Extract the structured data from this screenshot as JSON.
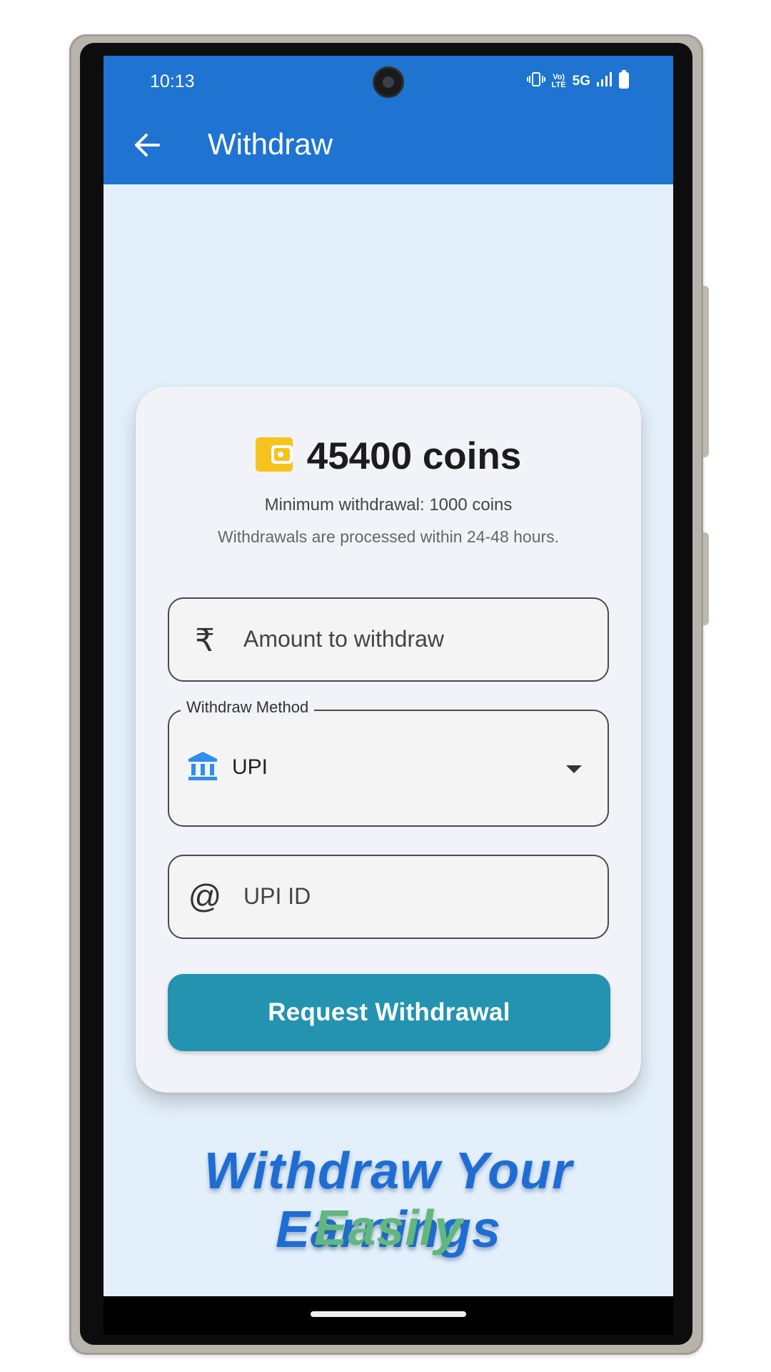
{
  "status_bar": {
    "time": "10:13",
    "icons": [
      "vibrate-icon",
      "volte-icon",
      "5g-icon",
      "signal-icon",
      "battery-icon"
    ],
    "volte_label": "Vo) LTE",
    "network_label": "5G"
  },
  "app_bar": {
    "title": "Withdraw",
    "background": "#1e74d0"
  },
  "balance": {
    "icon": "wallet-icon",
    "icon_color": "#f6c31c",
    "text": "45400 coins"
  },
  "info": {
    "minimum": "Minimum withdrawal: 1000 coins",
    "processing": "Withdrawals are processed within 24-48 hours."
  },
  "amount_field": {
    "icon": "rupee-icon",
    "placeholder": "Amount to withdraw"
  },
  "method_select": {
    "label": "Withdraw Method",
    "icon": "bank-icon",
    "icon_color": "#2d8ef0",
    "value": "UPI"
  },
  "upi_field": {
    "icon": "at-icon",
    "placeholder": "UPI ID"
  },
  "submit_button": {
    "label": "Request Withdrawal",
    "color": "#2393b0"
  },
  "promo": {
    "line1": "Withdraw Your Earnings",
    "line2": "Easily",
    "line1_color": "#1f6dd2",
    "line2_color": "#62b67f"
  }
}
